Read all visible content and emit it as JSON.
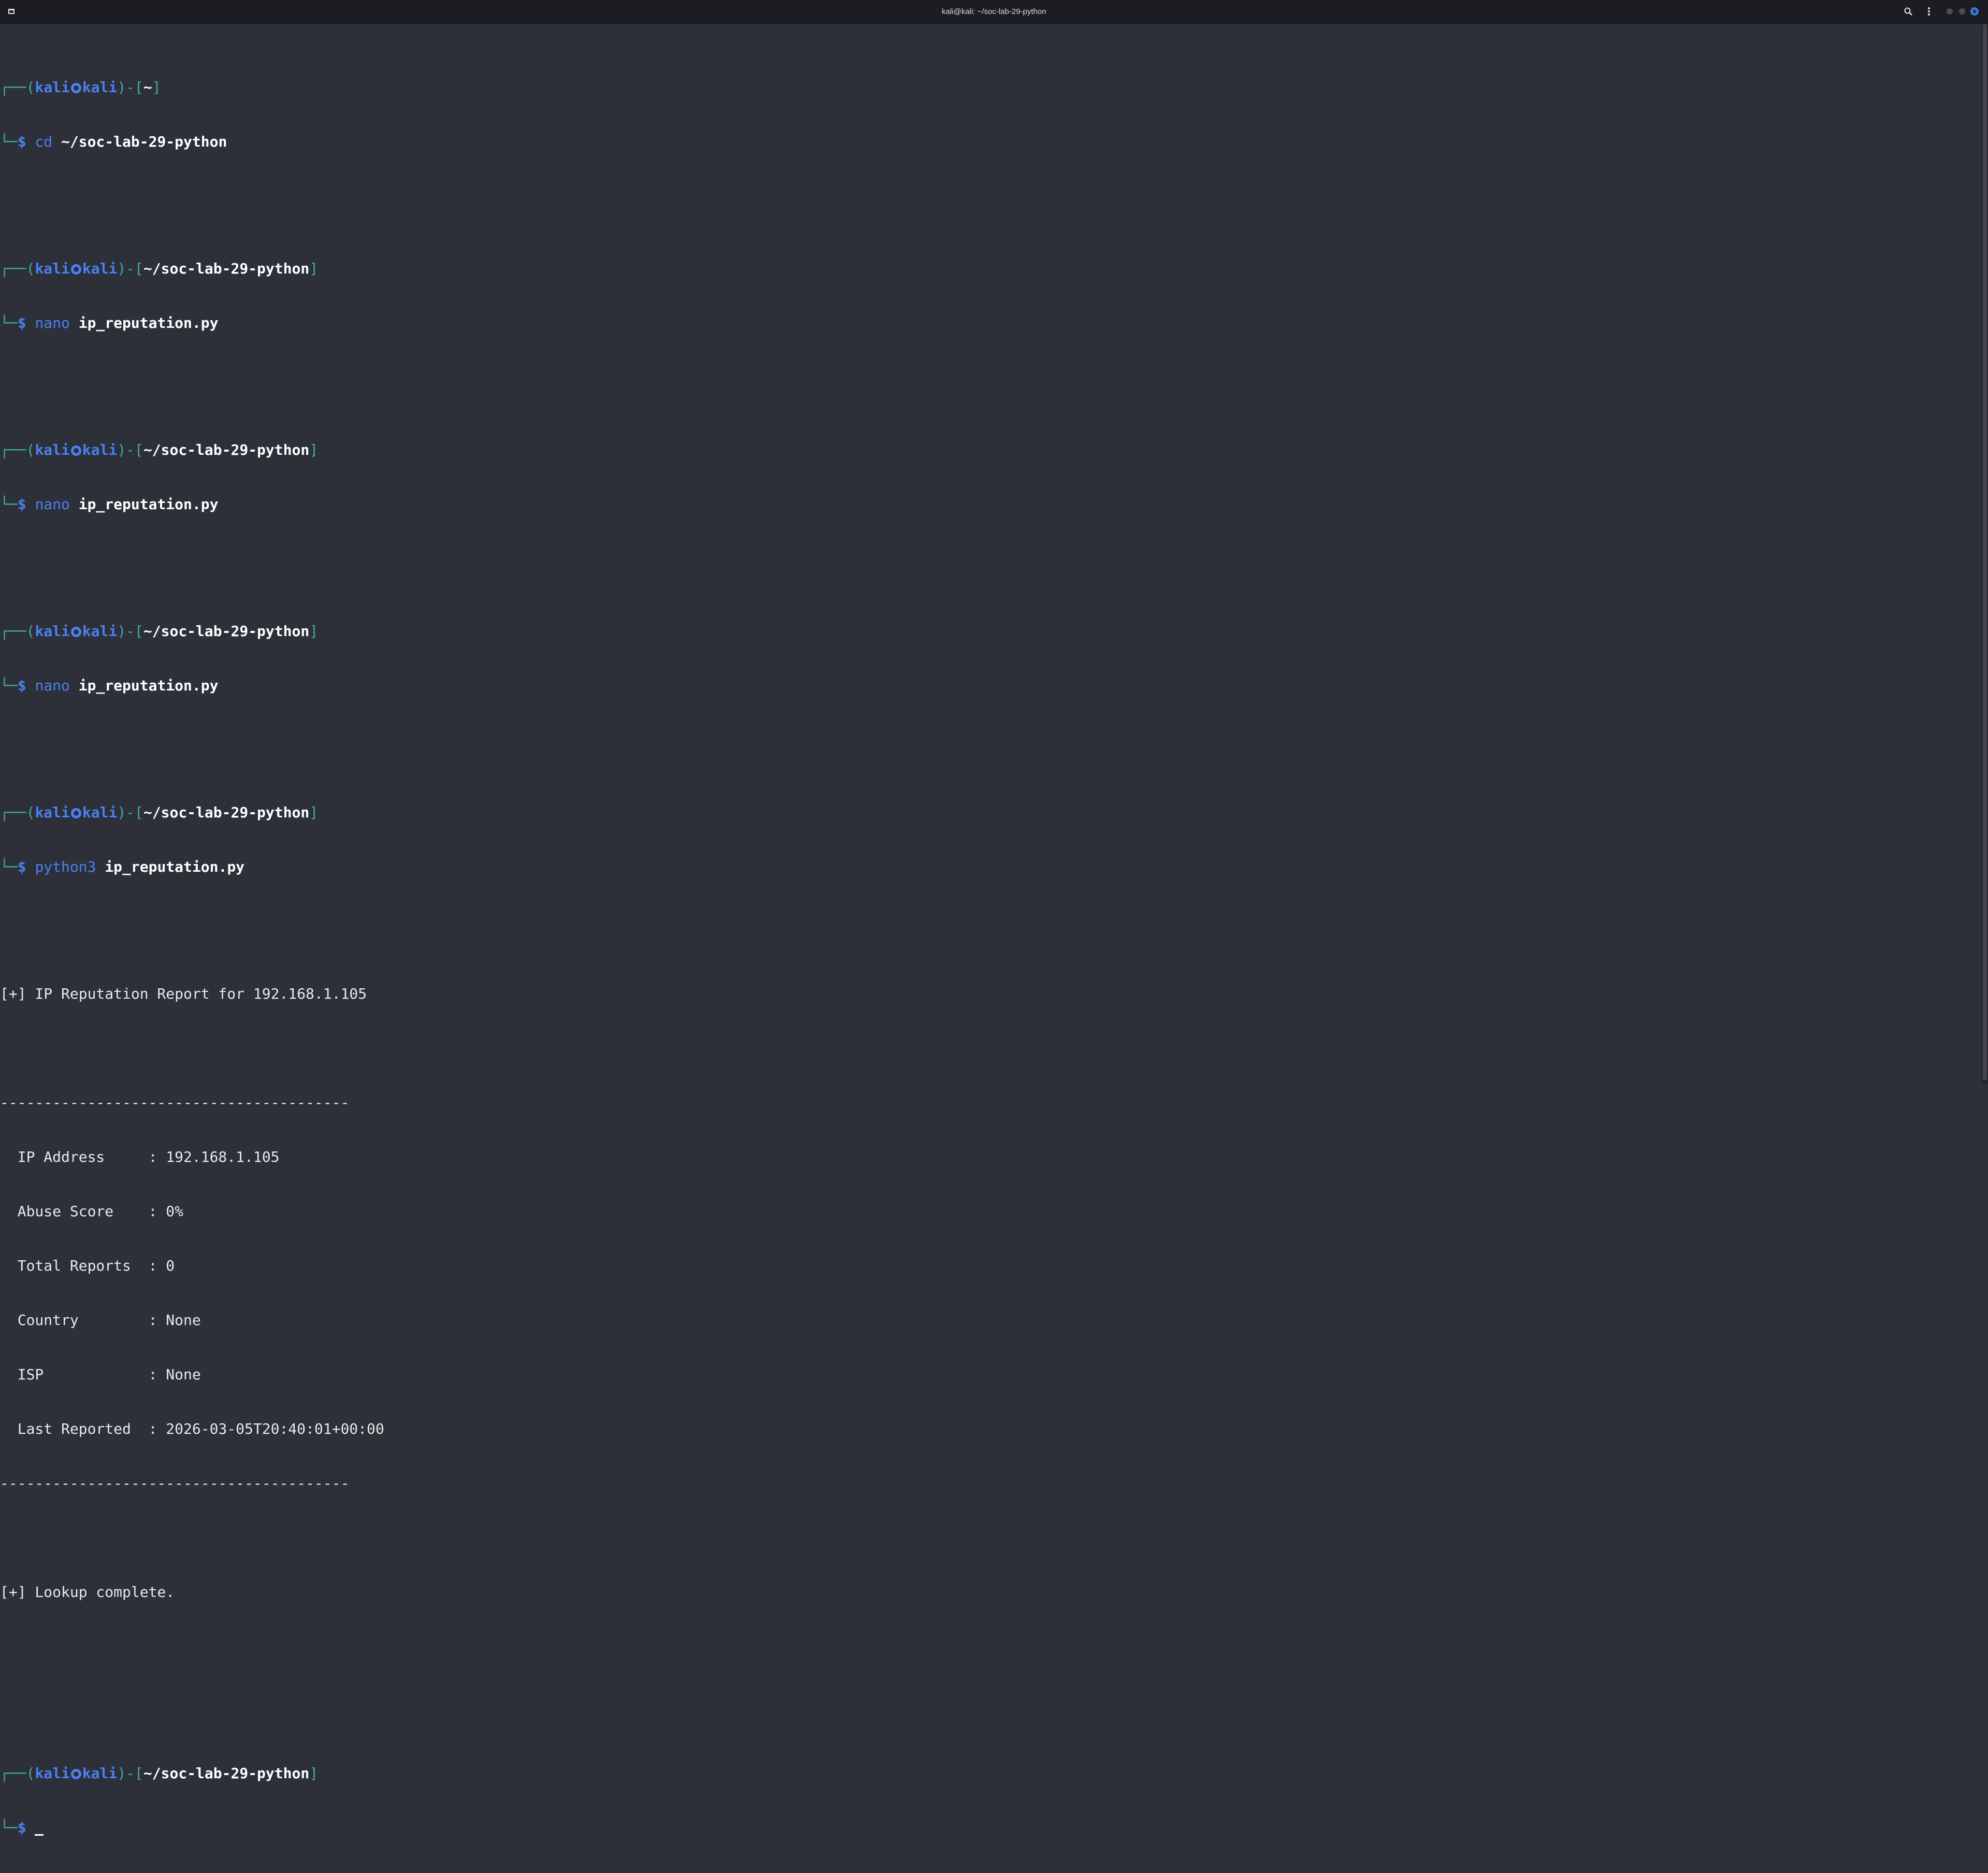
{
  "window": {
    "title": "kali@kali: ~/soc-lab-29-python"
  },
  "icons": {
    "app": "terminal-app-icon",
    "search": "search-icon",
    "menu": "kebab-menu-icon",
    "minimize": "minimize-icon",
    "maximize": "maximize-icon",
    "close": "close-icon"
  },
  "colors": {
    "background": "#2e3039",
    "prompt_frame": "#3fa9a5",
    "prompt_user": "#4a80f0",
    "close_button": "#3b7de0"
  },
  "prompt": {
    "corner_top": "┌──(",
    "user": "kali",
    "host": "kali",
    "sep": ")-[",
    "close_bracket": "]",
    "corner_bottom": "└─",
    "dollar": "$"
  },
  "session": [
    {
      "path": "~",
      "cmd": "cd",
      "arg": "~/soc-lab-29-python"
    },
    {
      "path": "~/soc-lab-29-python",
      "cmd": "nano",
      "arg": "ip_reputation.py"
    },
    {
      "path": "~/soc-lab-29-python",
      "cmd": "nano",
      "arg": "ip_reputation.py"
    },
    {
      "path": "~/soc-lab-29-python",
      "cmd": "nano",
      "arg": "ip_reputation.py"
    },
    {
      "path": "~/soc-lab-29-python",
      "cmd": "python3",
      "arg": "ip_reputation.py"
    }
  ],
  "output": {
    "header": "[+] IP Reputation Report for 192.168.1.105",
    "divider": "----------------------------------------",
    "rows": [
      "  IP Address     : 192.168.1.105",
      "  Abuse Score    : 0%",
      "  Total Reports  : 0",
      "  Country        : None",
      "  ISP            : None",
      "  Last Reported  : 2026-03-05T20:40:01+00:00"
    ],
    "footer": "[+] Lookup complete."
  },
  "final_prompt": {
    "path": "~/soc-lab-29-python"
  }
}
